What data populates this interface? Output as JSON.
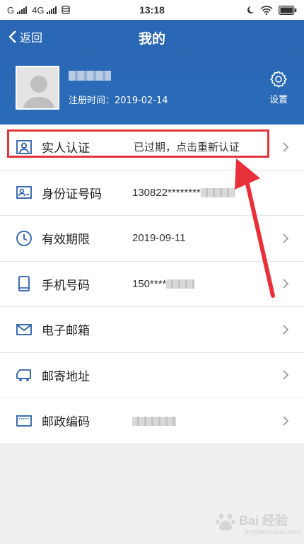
{
  "status_bar": {
    "network_left": "G",
    "network_mid": "4G",
    "time": "13:18"
  },
  "header": {
    "back_label": "返回",
    "title": "我的",
    "register_label": "注册时间：2019-02-14",
    "settings_label": "设置"
  },
  "list": [
    {
      "label": "实人认证",
      "value": "已过期，点击重新认证",
      "icon": "face-id-icon",
      "chevron": true
    },
    {
      "label": "身份证号码",
      "value": "130822********",
      "icon": "id-card-icon",
      "chevron": false
    },
    {
      "label": "有效期限",
      "value": "2019-09-11",
      "icon": "clock-icon",
      "chevron": true
    },
    {
      "label": "手机号码",
      "value": "150****",
      "icon": "phone-icon",
      "chevron": true
    },
    {
      "label": "电子邮箱",
      "value": "",
      "icon": "mail-icon",
      "chevron": true
    },
    {
      "label": "邮寄地址",
      "value": "",
      "icon": "truck-icon",
      "chevron": true
    },
    {
      "label": "邮政编码",
      "value": "",
      "icon": "postcode-icon",
      "chevron": true
    }
  ],
  "watermark": {
    "main": "Bai 经验",
    "sub": "jingyan.baidu.com"
  },
  "colors": {
    "header_blue": "#2a66b3",
    "icon_blue": "#2a5fa8",
    "highlight_red": "#e0353b"
  }
}
